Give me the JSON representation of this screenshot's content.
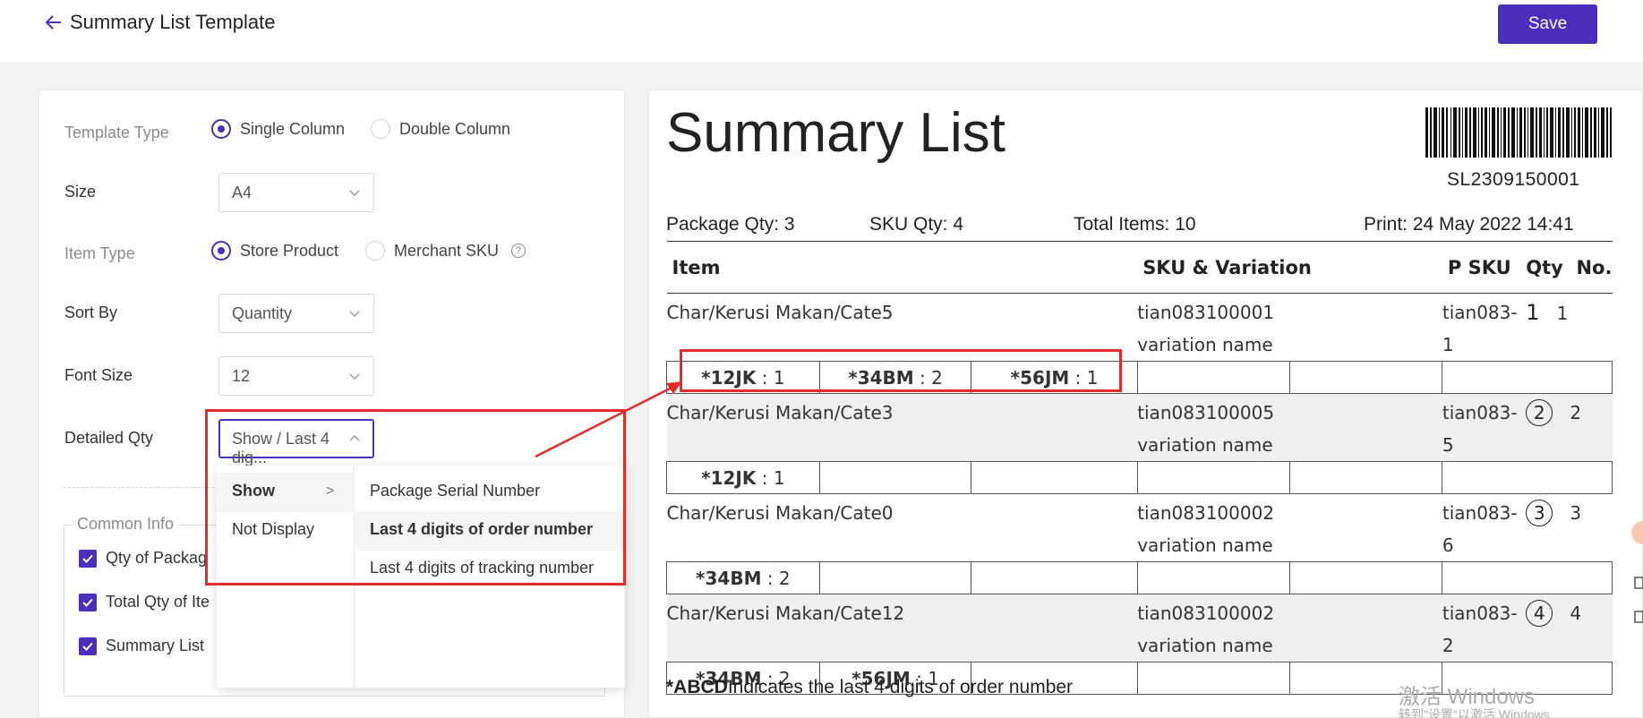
{
  "header": {
    "title": "Summary List Template",
    "save_label": "Save"
  },
  "settings": {
    "template_type": {
      "label": "Template Type",
      "options": [
        "Single Column",
        "Double Column"
      ],
      "selected": "Single Column"
    },
    "size": {
      "label": "Size",
      "value": "A4"
    },
    "item_type": {
      "label": "Item Type",
      "options": [
        "Store Product",
        "Merchant SKU"
      ],
      "selected": "Store Product"
    },
    "sort_by": {
      "label": "Sort By",
      "value": "Quantity"
    },
    "font_size": {
      "label": "Font Size",
      "value": "12"
    },
    "detailed_qty": {
      "label": "Detailed Qty",
      "value": "Show / Last 4 dig..."
    },
    "common_info": {
      "legend": "Common Info",
      "checks": [
        "Qty of Packag",
        "Total Qty of Ite",
        "Summary List"
      ]
    }
  },
  "dropdown": {
    "level1": [
      "Show",
      "Not Display"
    ],
    "level2": [
      "Package Serial Number",
      "Last 4 digits of order number",
      "Last 4 digits of tracking number"
    ],
    "active_level1": "Show",
    "active_level2": "Last 4 digits of order number"
  },
  "preview": {
    "title": "Summary List",
    "sl_number": "SL2309150001",
    "package_qty": "Package Qty: 3",
    "sku_qty": "SKU Qty: 4",
    "total_items": "Total Items: 10",
    "print_time": "Print: 24 May 2022 14:41",
    "columns": [
      "Item",
      "SKU & Variation",
      "P SKU",
      "Qty",
      "No."
    ],
    "rows": [
      {
        "item": "Char/Kerusi Makan/Cate5",
        "sku": "tian083100001",
        "variation": "variation name",
        "psku": "tian083-1",
        "qty": "1",
        "no": "1",
        "details": [
          {
            "code": "*12JK",
            "qty": " : 1"
          },
          {
            "code": "*34BM",
            "qty": " : 2"
          },
          {
            "code": "*56JM",
            "qty": " : 1"
          }
        ]
      },
      {
        "item": "Char/Kerusi Makan/Cate3",
        "sku": "tian083100005",
        "variation": "variation name",
        "psku": "tian083-5",
        "qty": "2",
        "no": "2",
        "details": [
          {
            "code": "*12JK",
            "qty": " : 1"
          }
        ]
      },
      {
        "item": "Char/Kerusi Makan/Cate0",
        "sku": "tian083100002",
        "variation": "variation name",
        "psku": "tian083-6",
        "qty": "3",
        "no": "3",
        "details": [
          {
            "code": "*34BM",
            "qty": " : 2"
          }
        ]
      },
      {
        "item": "Char/Kerusi Makan/Cate12",
        "sku": "tian083100002",
        "variation": "variation name",
        "psku": "tian083-2",
        "qty": "4",
        "no": "4",
        "details": [
          {
            "code": "*34BM",
            "qty": " : 2"
          },
          {
            "code": "*56JM",
            "qty": " : 1"
          }
        ]
      }
    ],
    "footnote_code": "*ABCD",
    "footnote_text": "Indicates the last 4 digits of order number"
  },
  "watermark": {
    "line1": "激活 Windows",
    "line2": "转到\"设置\"以激活 Windows"
  },
  "colors": {
    "accent": "#4a2fbd",
    "callout_red": "#e32b2b"
  }
}
